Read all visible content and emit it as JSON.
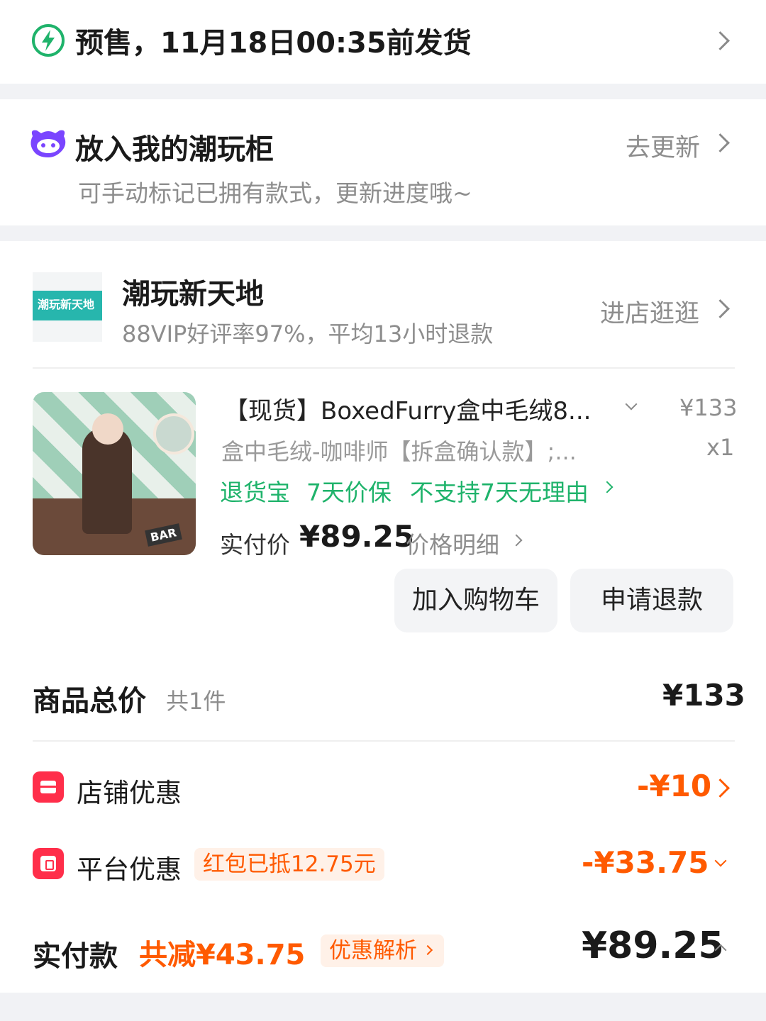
{
  "delivery": {
    "text": "预售，11月18日00:35前发货",
    "icon": "lightning-icon"
  },
  "cabinet": {
    "title": "放入我的潮玩柜",
    "subtitle": "可手动标记已拥有款式，更新进度哦~",
    "action": "去更新",
    "icon": "mascot-icon"
  },
  "shop": {
    "logo_text": "潮玩新天地",
    "name": "潮玩新天地",
    "stats": "88VIP好评率97%，平均13小时退款",
    "enter": "进店逛逛"
  },
  "item": {
    "title": "【现货】BoxedFurry盒中毛绒8...",
    "variant": "盒中毛绒-咖啡师【拆盒确认款】;...",
    "price": "¥133",
    "qty": "x1",
    "tags": [
      "退货宝",
      "7天价保",
      "不支持7天无理由"
    ],
    "paid_label": "实付价",
    "paid_value": "¥89.25",
    "price_detail": "价格明细",
    "image_text": "BAR",
    "add_to_cart": "加入购物车",
    "refund": "申请退款"
  },
  "summary": {
    "total_label": "商品总价",
    "total_count": "共1件",
    "total_value": "¥133",
    "shop_discount_label": "店铺优惠",
    "shop_discount_value": "-¥10",
    "platform_discount_label": "平台优惠",
    "platform_discount_badge": "红包已抵12.75元",
    "platform_discount_value": "-¥33.75",
    "paid_label": "实付款",
    "paid_reduce": "共减¥43.75",
    "paid_analysis": "优惠解析",
    "paid_value": "¥89.25"
  },
  "colors": {
    "green": "#1fb36b",
    "orange": "#ff5a00",
    "red": "#ff2e4a",
    "purple": "#7a45ff"
  }
}
